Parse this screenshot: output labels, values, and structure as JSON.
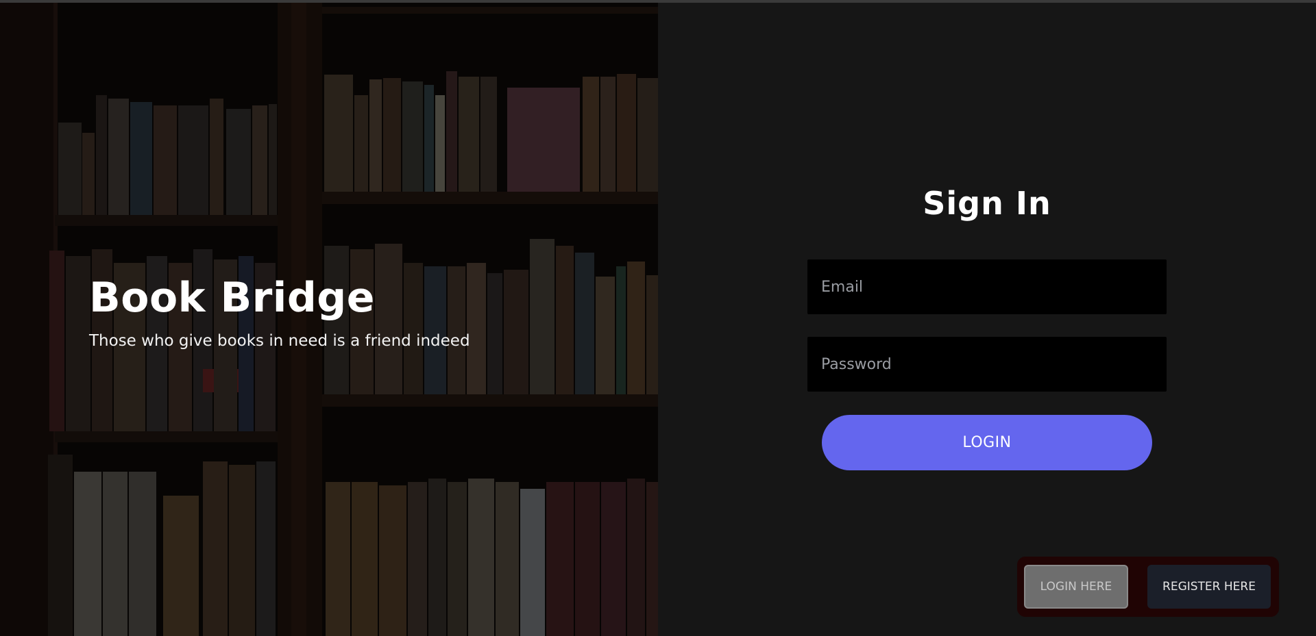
{
  "hero": {
    "title": "Book Bridge",
    "subtitle": "Those who give books in need is a friend indeed",
    "background_image": "bookshelf-photo"
  },
  "signin": {
    "title": "Sign In",
    "email_placeholder": "Email",
    "email_value": "",
    "password_placeholder": "Password",
    "password_value": "",
    "login_label": "LOGIN"
  },
  "switcher": {
    "login_label": "LOGIN HERE",
    "register_label": "REGISTER HERE",
    "active": "login"
  },
  "colors": {
    "accent": "#6466ee",
    "panel_bg": "#161616",
    "field_bg": "#000000",
    "switcher_bg": "#200404",
    "register_bg": "#1b1f29",
    "login_here_bg": "#6e6e6e"
  }
}
